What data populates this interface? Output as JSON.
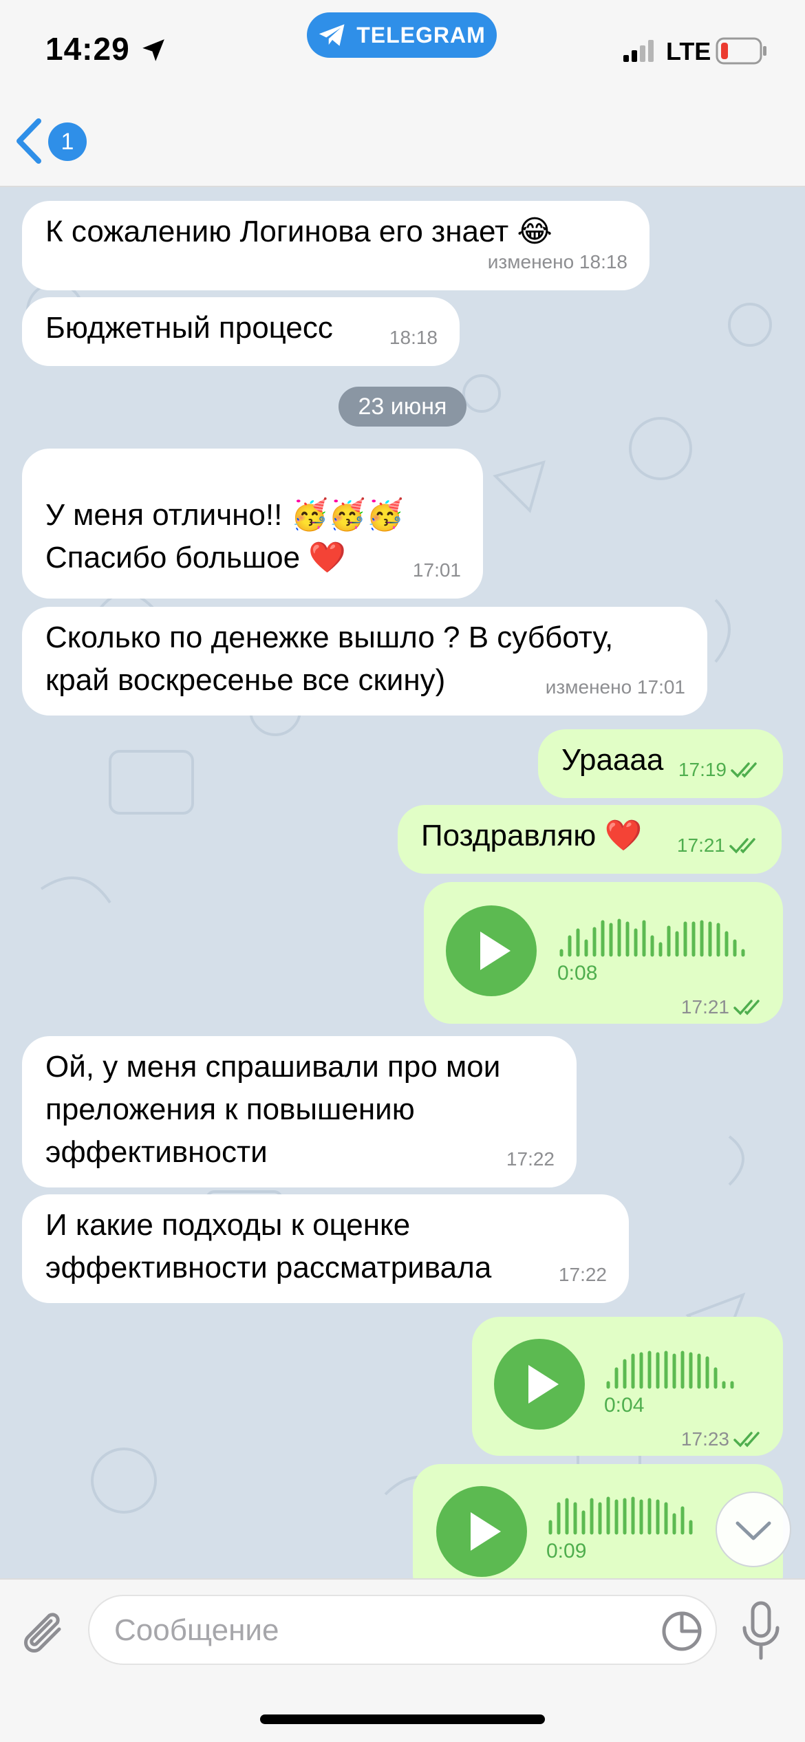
{
  "status_bar": {
    "time": "14:29",
    "app_pill": "TELEGRAM",
    "network": "LTE",
    "icons": [
      "location-arrow-icon",
      "telegram-icon",
      "signal-icon",
      "battery-icon"
    ]
  },
  "nav": {
    "unread_count": "1",
    "icons": [
      "chevron-left-icon"
    ]
  },
  "date_separator": "23 июня",
  "messages": [
    {
      "dir": "in",
      "text": "К сожалению Логинова его знает 😂",
      "time": "изменено 18:18"
    },
    {
      "dir": "in",
      "text": "Бюджетный процесс",
      "time": "18:18"
    },
    {
      "dir": "in",
      "text": "У меня отлично!! 🥳🥳🥳\nСпасибо большое ❤️",
      "time": "17:01"
    },
    {
      "dir": "in",
      "text": "Сколько по денежке вышло ?  В субботу,\nкрай воскресенье все скину)",
      "time": "изменено 17:01"
    },
    {
      "dir": "out",
      "text": "Урaaaa",
      "time": "17:19"
    },
    {
      "dir": "out",
      "text": "Поздравляю ❤️",
      "time": "17:21"
    },
    {
      "dir": "out",
      "type": "voice",
      "duration": "0:08",
      "time": "17:21"
    },
    {
      "dir": "in",
      "text": "Ой, у меня спрашивали про мои\nпреложения к повышению\nэффективности",
      "time": "17:22"
    },
    {
      "dir": "in",
      "text": "И какие подходы к оценке\nэффективности рассматривала",
      "time": "17:22"
    },
    {
      "dir": "out",
      "type": "voice",
      "duration": "0:04",
      "time": "17:23"
    },
    {
      "dir": "out",
      "type": "voice",
      "duration": "0:09",
      "time": ""
    }
  ],
  "input": {
    "placeholder": "Сообщение",
    "value": ""
  },
  "colors": {
    "accent": "#2f8fe8",
    "outgoing_bubble": "#e1fec6",
    "play_button": "#5cba51",
    "chat_bg": "#d5dfe9"
  }
}
